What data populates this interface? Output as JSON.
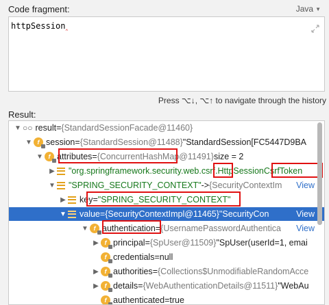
{
  "header": {
    "label": "Code fragment:",
    "language": "Java"
  },
  "editor": {
    "code": "httpSession",
    "cursor_mark": "‸"
  },
  "hint": "Press ⌥↓, ⌥↑ to navigate through the history",
  "result_label": "Result:",
  "tree": {
    "result": {
      "name": "result",
      "eq": " = ",
      "ref": "{StandardSessionFacade@11460}"
    },
    "session": {
      "name": "session",
      "eq": " = ",
      "ref": "{StandardSession@11488}",
      "value": " \"StandardSession[FC5447D9BA"
    },
    "attributes": {
      "name": "attributes",
      "eq": " = ",
      "ref": "{ConcurrentHashMap@11491}",
      "size": " size = 2"
    },
    "csrf_entry": {
      "pre": "\"org.springframework.security.web.",
      "hl1": "csrf.",
      "mid": "HttpSession",
      "hl2": "CsrfToken"
    },
    "spring_ctx": {
      "key": "\"SPRING_SECURITY_CONTEXT\"",
      "arrow": " -> ",
      "ref": "{SecurityContextIm",
      "view": "View"
    },
    "key_row": {
      "name": "key",
      "eq": " = ",
      "value": "\"SPRING_SECURITY_CONTEXT\""
    },
    "value_row": {
      "name": "value",
      "eq": " = ",
      "ref": "{SecurityContextImpl@11465}",
      "value": " \"SecurityCon",
      "view": "View"
    },
    "authentication": {
      "name": "authentication",
      "eq": " = ",
      "ref": "{UsernamePasswordAuthentica",
      "view": "View"
    },
    "principal": {
      "name": "principal",
      "eq": " = ",
      "ref": "{SpUser@11509}",
      "value": " \"SpUser(userId=1, emai"
    },
    "credentials": {
      "name": "credentials",
      "eq": " = ",
      "value": "null"
    },
    "authorities": {
      "name": "authorities",
      "eq": " = ",
      "ref": "{Collections$UnmodifiableRandomAcce"
    },
    "details": {
      "name": "details",
      "eq": " = ",
      "ref": "{WebAuthenticationDetails@11511}",
      "value": " \"WebAu"
    },
    "authenticated": {
      "name": "authenticated",
      "eq": " = ",
      "value": "true"
    }
  },
  "colors": {
    "selection": "#2f6fc9",
    "highlight_box": "#e01010",
    "field_icon": "#f2b134",
    "string": "#16781b"
  }
}
